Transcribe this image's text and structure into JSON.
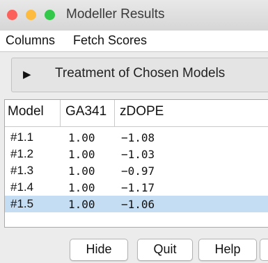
{
  "window": {
    "title": "Modeller Results"
  },
  "menu": [
    "Columns",
    "Fetch Scores"
  ],
  "disclosure": {
    "label": "Treatment of Chosen Models",
    "state": "collapsed"
  },
  "table": {
    "columns": [
      "Model",
      "GA341",
      "zDOPE"
    ],
    "rows": [
      {
        "model": "#1.1",
        "ga341": "1.00",
        "zdope": "−1.08",
        "selected": false
      },
      {
        "model": "#1.2",
        "ga341": "1.00",
        "zdope": "−1.03",
        "selected": false
      },
      {
        "model": "#1.3",
        "ga341": "1.00",
        "zdope": "−0.97",
        "selected": false
      },
      {
        "model": "#1.4",
        "ga341": "1.00",
        "zdope": "−1.17",
        "selected": false
      },
      {
        "model": "#1.5",
        "ga341": "1.00",
        "zdope": "−1.06",
        "selected": true
      }
    ]
  },
  "buttons": {
    "hide": "Hide",
    "quit": "Quit",
    "help": "Help"
  },
  "colors": {
    "selection": "#c5ddf3",
    "close": "#fc605b",
    "minimize": "#fdbc40",
    "maximize": "#34c84a"
  }
}
